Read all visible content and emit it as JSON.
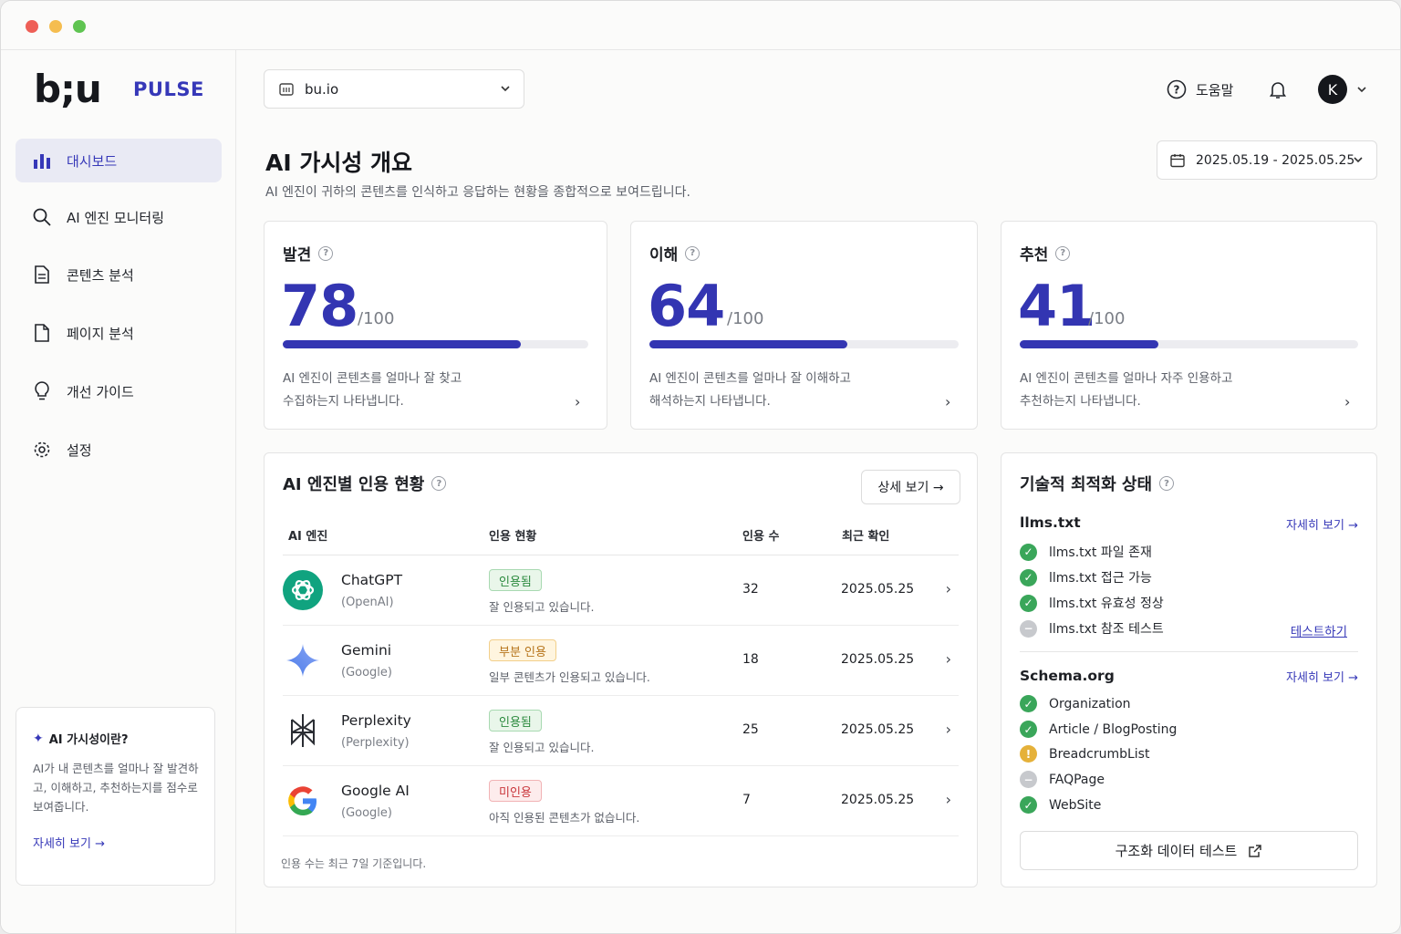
{
  "brand": {
    "logo": "b;u",
    "product": "PULSE"
  },
  "sidebar": {
    "items": [
      {
        "label": "대시보드",
        "icon": "bar-chart-icon",
        "active": true
      },
      {
        "label": "AI 엔진 모니터링",
        "icon": "search-icon"
      },
      {
        "label": "콘텐츠 분석",
        "icon": "document-icon"
      },
      {
        "label": "페이지 분석",
        "icon": "page-icon"
      },
      {
        "label": "개선 가이드",
        "icon": "lightbulb-icon"
      },
      {
        "label": "설정",
        "icon": "gear-icon"
      }
    ],
    "help_box": {
      "title": "AI 가시성이란?",
      "body": "AI가 내 콘텐츠를 얼마나 잘 발견하고, 이해하고, 추천하는지를 점수로 보여줍니다.",
      "link": "자세히 보기 →"
    }
  },
  "header": {
    "site": "bu.io",
    "help": "도움말",
    "avatar": "K"
  },
  "page": {
    "title": "AI 가시성 개요",
    "subtitle": "AI 엔진이 귀하의 콘텐츠를 인식하고 응답하는 현황을 종합적으로 보여드립니다.",
    "date_range": "2025.05.19 - 2025.05.25"
  },
  "scores": [
    {
      "title": "발견",
      "value": "78",
      "max": "/100",
      "fraction": 0.78,
      "desc1": "AI 엔진이 콘텐츠를 얼마나 잘 찾고",
      "desc2": "수집하는지 나타냅니다."
    },
    {
      "title": "이해",
      "value": "64",
      "max": "/100",
      "fraction": 0.64,
      "desc1": "AI 엔진이 콘텐츠를 얼마나 잘 이해하고",
      "desc2": "해석하는지 나타냅니다."
    },
    {
      "title": "추천",
      "value": "41",
      "max": "/100",
      "fraction": 0.41,
      "desc1": "AI 엔진이 콘텐츠를 얼마나 자주 인용하고",
      "desc2": "추천하는지 나타냅니다."
    }
  ],
  "citations": {
    "title": "AI 엔진별 인용 현황",
    "detail_button": "상세 보기 →",
    "columns": [
      "AI 엔진",
      "인용 현황",
      "인용 수",
      "최근 확인"
    ],
    "rows": [
      {
        "name": "ChatGPT",
        "company": "(OpenAI)",
        "badge": "인용됨",
        "badge_type": "ok",
        "status": "잘 인용되고 있습니다.",
        "count": "32",
        "date": "2025.05.25",
        "icon": "chatgpt-icon"
      },
      {
        "name": "Gemini",
        "company": "(Google)",
        "badge": "부분 인용",
        "badge_type": "part",
        "status": "일부 콘텐츠가 인용되고 있습니다.",
        "count": "18",
        "date": "2025.05.25",
        "icon": "gemini-icon"
      },
      {
        "name": "Perplexity",
        "company": "(Perplexity)",
        "badge": "인용됨",
        "badge_type": "ok",
        "status": "잘 인용되고 있습니다.",
        "count": "25",
        "date": "2025.05.25",
        "icon": "perplexity-icon"
      },
      {
        "name": "Google AI",
        "company": "(Google)",
        "badge": "미인용",
        "badge_type": "no",
        "status": "아직 인용된 콘텐츠가 없습니다.",
        "count": "7",
        "date": "2025.05.25",
        "icon": "google-icon"
      }
    ],
    "footnote": "인용 수는 최근 7일 기준입니다."
  },
  "tech": {
    "title": "기술적 최적화 상태",
    "llms": {
      "title": "llms.txt",
      "more": "자세히 보기 →",
      "items": [
        {
          "label": "llms.txt 파일 존재",
          "state": "ok"
        },
        {
          "label": "llms.txt 접근 가능",
          "state": "ok"
        },
        {
          "label": "llms.txt 유효성 정상",
          "state": "ok"
        },
        {
          "label": "llms.txt 참조 테스트",
          "state": "na"
        }
      ],
      "test_link": "테스트하기"
    },
    "schema": {
      "title": "Schema.org",
      "more": "자세히 보기 →",
      "items": [
        {
          "label": "Organization",
          "state": "ok"
        },
        {
          "label": "Article / BlogPosting",
          "state": "ok"
        },
        {
          "label": "BreadcrumbList",
          "state": "warn"
        },
        {
          "label": "FAQPage",
          "state": "na"
        },
        {
          "label": "WebSite",
          "state": "ok"
        }
      ]
    },
    "struct_button": "구조화 데이터 테스트"
  },
  "colors": {
    "accent": "#3335b2",
    "ok": "#3aa65a",
    "warn": "#e5b13a",
    "na": "#c7c9cd"
  }
}
